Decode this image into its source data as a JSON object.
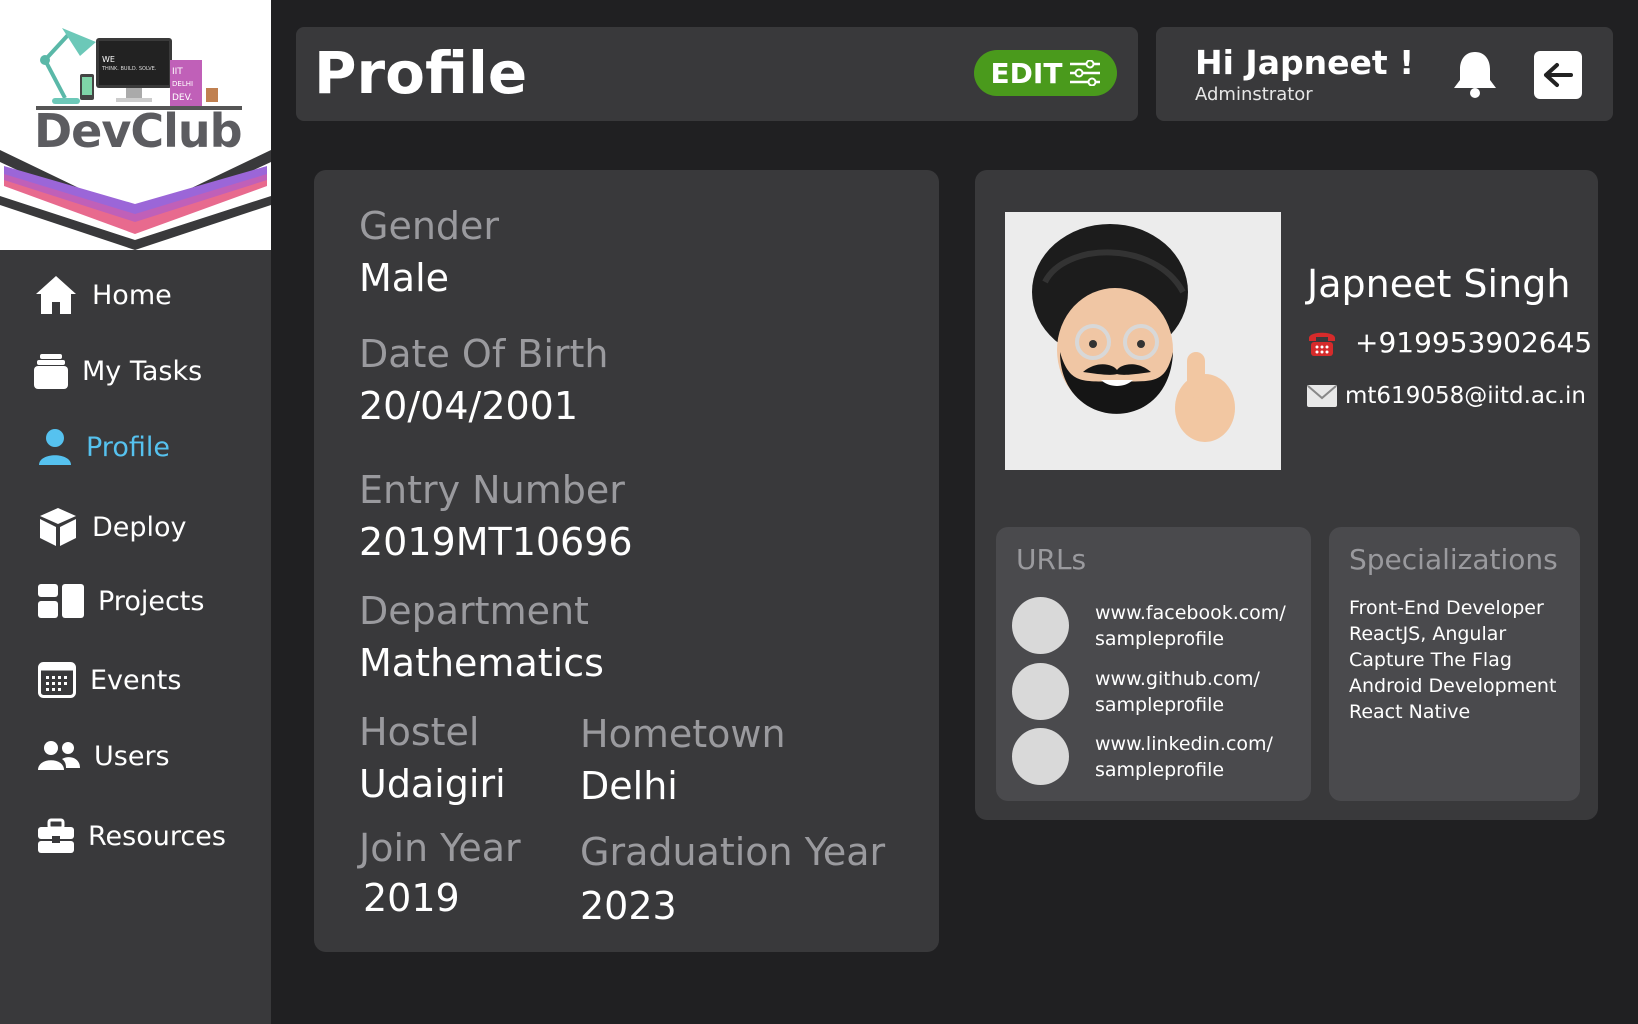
{
  "brand": {
    "name": "DevClub",
    "tagline": "WE THINK. BUILD. SOLVE.",
    "badge": [
      "IIT",
      "DELHI",
      "DEV."
    ]
  },
  "nav": [
    {
      "label": "Home",
      "icon": "home-icon"
    },
    {
      "label": "My Tasks",
      "icon": "tasks-icon"
    },
    {
      "label": "Profile",
      "icon": "user-icon",
      "active": true
    },
    {
      "label": "Deploy",
      "icon": "box-icon"
    },
    {
      "label": "Projects",
      "icon": "projects-icon"
    },
    {
      "label": "Events",
      "icon": "calendar-icon"
    },
    {
      "label": "Users",
      "icon": "users-icon"
    },
    {
      "label": "Resources",
      "icon": "toolbox-icon"
    }
  ],
  "header": {
    "title": "Profile",
    "edit_label": "EDIT"
  },
  "user": {
    "greeting": "Hi Japneet !",
    "role": "Adminstrator"
  },
  "info": {
    "gender_label": "Gender",
    "gender": "Male",
    "dob_label": "Date Of Birth",
    "dob": "20/04/2001",
    "entry_label": "Entry Number",
    "entry": "2019MT10696",
    "dept_label": "Department",
    "dept": "Mathematics",
    "hostel_label": "Hostel",
    "hostel": "Udaigiri",
    "hometown_label": "Hometown",
    "hometown": "Delhi",
    "join_label": "Join Year",
    "join": "2019",
    "grad_label": "Graduation Year",
    "grad": "2023"
  },
  "profile": {
    "name": "Japneet Singh",
    "phone": "+919953902645",
    "email": "mt619058@iitd.ac.in"
  },
  "urls": {
    "title": "URLs",
    "items": [
      "www.facebook.com/ sampleprofile",
      "www.github.com/ sampleprofile",
      "www.linkedin.com/ sampleprofile"
    ]
  },
  "specializations": {
    "title": "Specializations",
    "items": [
      "Front-End Developer",
      "ReactJS, Angular",
      "Capture The Flag",
      "Android Development",
      "React Native"
    ]
  },
  "colors": {
    "accent": "#56c2ef",
    "edit": "#4a9a1c",
    "card": "#39393b",
    "bg": "#202022"
  }
}
